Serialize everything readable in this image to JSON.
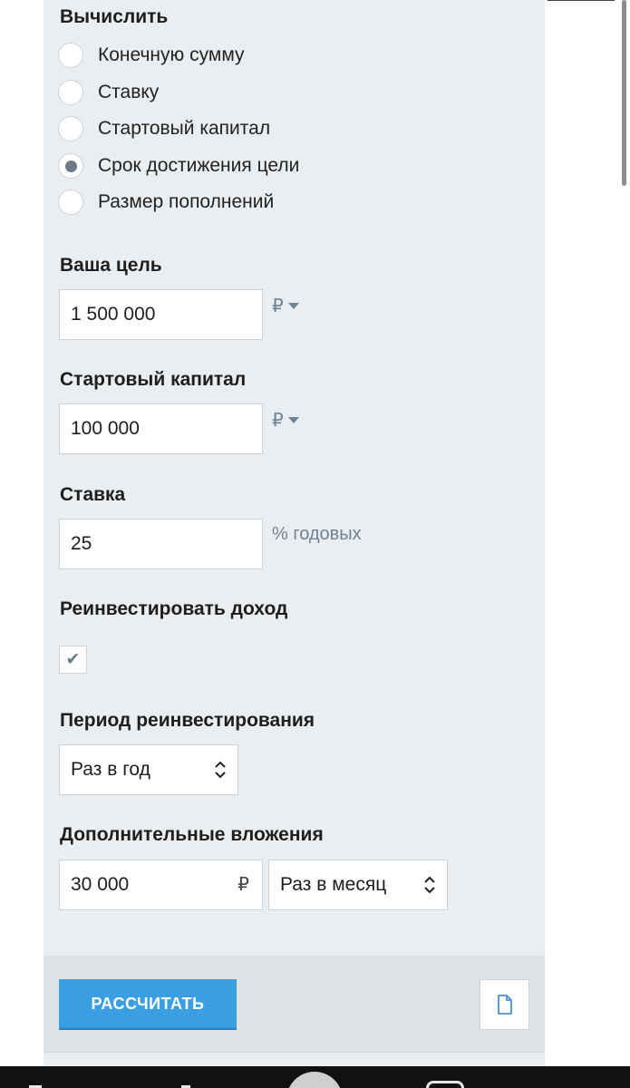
{
  "calc": {
    "title": "Вычислить",
    "options": [
      {
        "label": "Конечную сумму",
        "checked": false
      },
      {
        "label": "Ставку",
        "checked": false
      },
      {
        "label": "Стартовый капитал",
        "checked": false
      },
      {
        "label": "Срок достижения цели",
        "checked": true
      },
      {
        "label": "Размер пополнений",
        "checked": false
      }
    ]
  },
  "goal": {
    "label": "Ваша цель",
    "value": "1 500 000",
    "unit": "₽"
  },
  "start": {
    "label": "Стартовый капитал",
    "value": "100 000",
    "unit": "₽"
  },
  "rate": {
    "label": "Ставка",
    "value": "25",
    "unit": "% годовых"
  },
  "reinvest": {
    "label": "Реинвестировать доход",
    "checked": true,
    "check_icon": "✔"
  },
  "period": {
    "label": "Период реинвестирования",
    "selected": "Раз в год"
  },
  "additional": {
    "label": "Дополнительные вложения",
    "value": "30 000",
    "unit": "₽",
    "frequency": "Раз в месяц"
  },
  "actions": {
    "calculate_label": "РАССЧИТАТЬ",
    "document_icon": "document-icon"
  },
  "colors": {
    "accent": "#3a9fe2",
    "panel": "#ebeef0",
    "unit_text": "#6f8396"
  }
}
